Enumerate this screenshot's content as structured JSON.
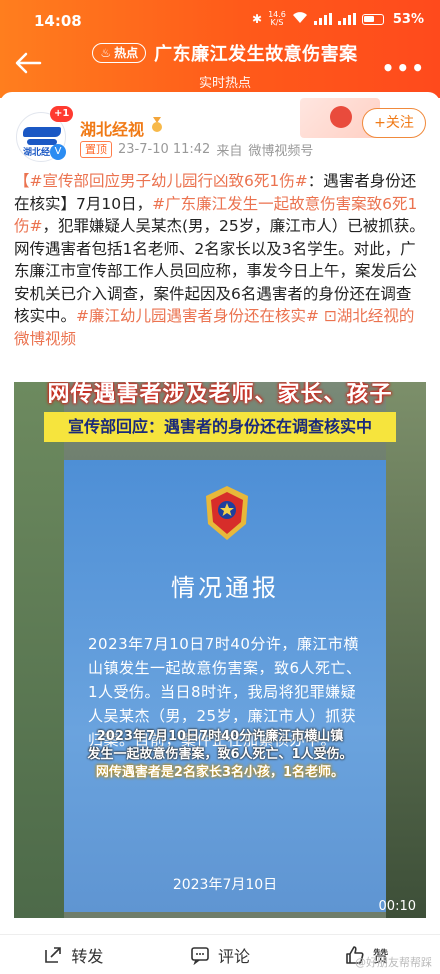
{
  "status_bar": {
    "time": "14:08",
    "speed": "14.6\nK/S",
    "battery": "53%"
  },
  "header": {
    "hot_label": "热点",
    "title": "广东廉江发生故意伤害案",
    "subtitle": "实时热点",
    "bg_color": "#ff5a1a"
  },
  "post": {
    "author": "湖北经视",
    "avatar_text": "湖北经视",
    "badge": "+1",
    "pin_label": "置顶",
    "timestamp": "23-7-10 11:42",
    "source_prefix": "来自",
    "source": "微博视频号",
    "follow_label": "+关注",
    "text_segments": [
      {
        "type": "link",
        "text": "【#宣传部回应男子幼儿园行凶致6死1伤#"
      },
      {
        "type": "plain",
        "text": "：遇害者身份还在核实】7月10日，"
      },
      {
        "type": "link",
        "text": "#广东廉江发生一起故意伤害案致6死1伤#"
      },
      {
        "type": "plain",
        "text": "，犯罪嫌疑人吴某杰(男，25岁，廉江市人）已被抓获。网传遇害者包括1名老师、2名家长以及3名学生。对此，广东廉江市宣传部工作人员回应称，事发今日上午，案发后公安机关已介入调查，案件起因及6名遇害者的身份还在调查核实中。"
      },
      {
        "type": "link",
        "text": "#廉江幼儿园遇害者身份还在核实#"
      },
      {
        "type": "link",
        "text": " ⊡湖北经视的微博视频"
      }
    ]
  },
  "video": {
    "headline": "网传遇害者涉及老师、家长、孩子",
    "subhead": "宣传部回应：遇害者的身份还在调查核实中",
    "notice_title": "情况通报",
    "notice_body": "2023年7月10日7时40分许，廉江市横山镇发生一起故意伤害案，致6人死亡、1人受伤。当日8时许，我局将犯罪嫌疑人吴某杰（男，25岁，廉江市人）抓获归案。目前，案件正在加紧侦办中。",
    "caption_line1": "2023年7月10日7时40分许廉江市横山镇",
    "caption_line2": "发生一起故意伤害案，致6人死亡、1人受伤。",
    "caption_line3": "网传遇害者是2名家长3名小孩，1名老师。",
    "notice_date": "2023年7月10日",
    "duration": "00:10"
  },
  "actions": {
    "repost": "转发",
    "comment": "评论",
    "like": "赞"
  },
  "watermark": "@好朋友帮帮踩"
}
